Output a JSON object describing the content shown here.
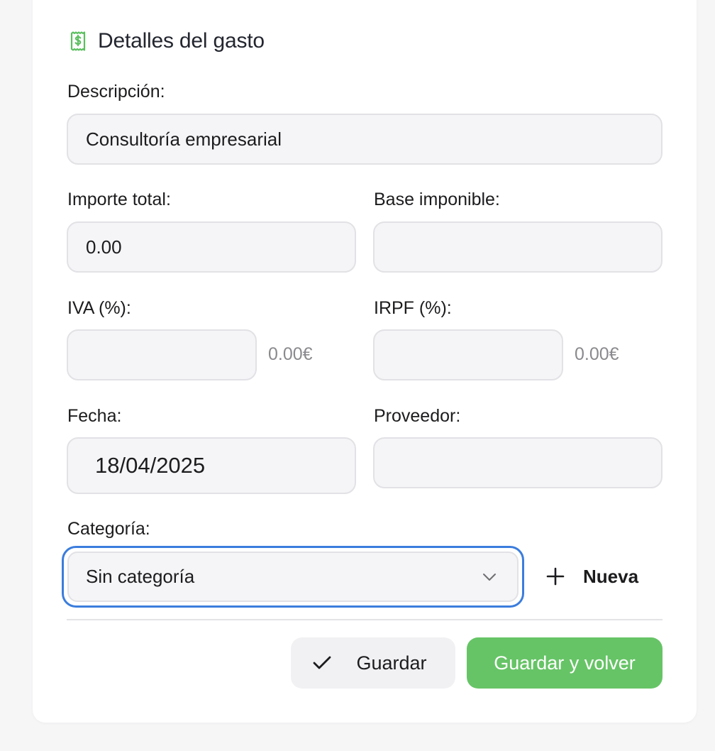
{
  "section": {
    "title": "Detalles del gasto",
    "icon": "receipt-dollar-icon",
    "accent_color": "#5bbf5f"
  },
  "form": {
    "description": {
      "label": "Descripción:",
      "value": "Consultoría empresarial"
    },
    "total_amount": {
      "label": "Importe total:",
      "value": "0.00"
    },
    "taxable_base": {
      "label": "Base imponible:",
      "value": ""
    },
    "iva": {
      "label": "IVA (%):",
      "value": "",
      "amount": "0.00€"
    },
    "irpf": {
      "label": "IRPF (%):",
      "value": "",
      "amount": "0.00€"
    },
    "date": {
      "label": "Fecha:",
      "value": "18/04/2025"
    },
    "supplier": {
      "label": "Proveedor:",
      "value": ""
    },
    "category": {
      "label": "Categoría:",
      "selected": "Sin categoría",
      "new_label": "Nueva"
    }
  },
  "actions": {
    "save_label": "Guardar",
    "save_and_back_label": "Guardar y volver",
    "primary_color": "#66c466",
    "focus_color": "#3b7ddd"
  }
}
